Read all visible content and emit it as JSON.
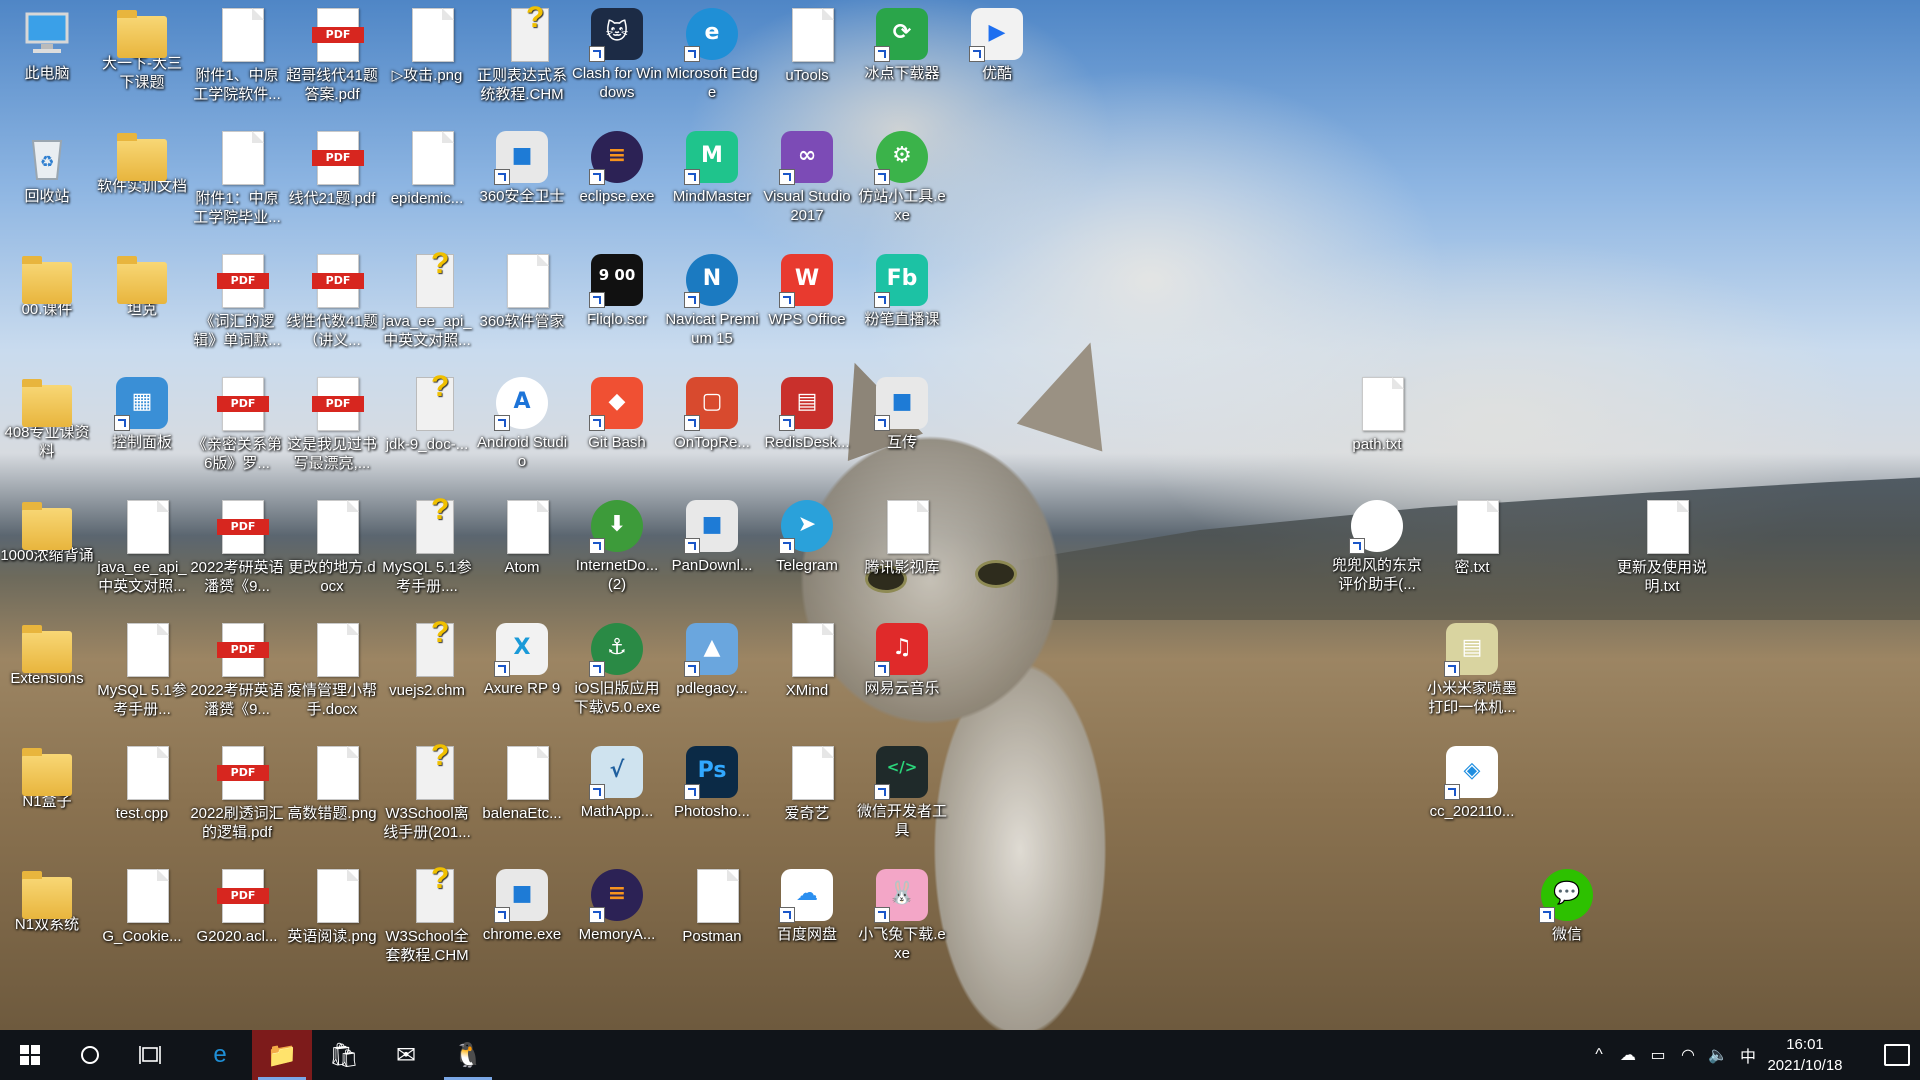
{
  "desktop": {
    "icons": [
      {
        "label": "此电脑",
        "col": 0,
        "row": 0,
        "kind": "computer"
      },
      {
        "label": "大一下-大三下课题",
        "col": 1,
        "row": 0,
        "kind": "folder"
      },
      {
        "label": "附件1、中原工学院软件...",
        "col": 2,
        "row": 0,
        "kind": "doc"
      },
      {
        "label": "超哥线代41题答案.pdf",
        "col": 3,
        "row": 0,
        "kind": "pdf"
      },
      {
        "label": "▷攻击.png",
        "col": 4,
        "row": 0,
        "kind": "doc"
      },
      {
        "label": "正则表达式系统教程.CHM",
        "col": 5,
        "row": 0,
        "kind": "chm"
      },
      {
        "label": "Clash for Windows",
        "col": 6,
        "row": 0,
        "kind": "app",
        "color": "#1c2b45",
        "text": "🐱"
      },
      {
        "label": "Microsoft Edge",
        "col": 7,
        "row": 0,
        "kind": "round",
        "color": "#1f8fd6",
        "text": "e"
      },
      {
        "label": "uTools",
        "col": 8,
        "row": 0,
        "kind": "doc"
      },
      {
        "label": "冰点下载器",
        "col": 9,
        "row": 0,
        "kind": "app",
        "color": "#2aa54a",
        "text": "⟳"
      },
      {
        "label": "优酷",
        "col": 10,
        "row": 0,
        "kind": "app",
        "color": "#f2f2f2",
        "text": "▶",
        "tcolor": "#1e6ff0"
      },
      {
        "label": "回收站",
        "col": 0,
        "row": 1,
        "kind": "bin"
      },
      {
        "label": "软件实训文档",
        "col": 1,
        "row": 1,
        "kind": "folder"
      },
      {
        "label": "附件1：中原工学院毕业...",
        "col": 2,
        "row": 1,
        "kind": "doc"
      },
      {
        "label": "线代21题.pdf",
        "col": 3,
        "row": 1,
        "kind": "pdf"
      },
      {
        "label": "epidemic...",
        "col": 4,
        "row": 1,
        "kind": "doc"
      },
      {
        "label": "360安全卫士",
        "col": 5,
        "row": 1,
        "kind": "app",
        "color": "#e8e8e8",
        "text": "■",
        "tcolor": "#1e7bd6"
      },
      {
        "label": "eclipse.exe",
        "col": 6,
        "row": 1,
        "kind": "round",
        "color": "#2c2255",
        "text": "≡",
        "tcolor": "#f7941e"
      },
      {
        "label": "MindMaster",
        "col": 7,
        "row": 1,
        "kind": "app",
        "color": "#1fc48c",
        "text": "M"
      },
      {
        "label": "Visual Studio 2017",
        "col": 8,
        "row": 1,
        "kind": "app",
        "color": "#7c4bb6",
        "text": "∞"
      },
      {
        "label": "仿站小工具.exe",
        "col": 9,
        "row": 1,
        "kind": "round",
        "color": "#3bb34a",
        "text": "⚙"
      },
      {
        "label": "00.课件",
        "col": 0,
        "row": 2,
        "kind": "folder"
      },
      {
        "label": "坦克",
        "col": 1,
        "row": 2,
        "kind": "folder"
      },
      {
        "label": "《词汇的逻辑》单词默...",
        "col": 2,
        "row": 2,
        "kind": "pdf"
      },
      {
        "label": "线性代数41题（讲义...",
        "col": 3,
        "row": 2,
        "kind": "pdf"
      },
      {
        "label": "java_ee_api_中英文对照...",
        "col": 4,
        "row": 2,
        "kind": "chm"
      },
      {
        "label": "360软件管家",
        "col": 5,
        "row": 2,
        "kind": "doc"
      },
      {
        "label": "Fliqlo.scr",
        "col": 6,
        "row": 2,
        "kind": "app",
        "color": "#111111",
        "text": "9 00"
      },
      {
        "label": "Navicat Premium 15",
        "col": 7,
        "row": 2,
        "kind": "round",
        "color": "#1b7ac1",
        "text": "N"
      },
      {
        "label": "WPS Office",
        "col": 8,
        "row": 2,
        "kind": "app",
        "color": "#e83a2f",
        "text": "W"
      },
      {
        "label": "粉笔直播课",
        "col": 9,
        "row": 2,
        "kind": "app",
        "color": "#1cc2a4",
        "text": "Fb"
      },
      {
        "label": "408专业课资料",
        "col": 0,
        "row": 3,
        "kind": "folder"
      },
      {
        "label": "控制面板",
        "col": 1,
        "row": 3,
        "kind": "app",
        "color": "#3a8fd6",
        "text": "▦"
      },
      {
        "label": "《亲密关系第6版》罗...",
        "col": 2,
        "row": 3,
        "kind": "pdf"
      },
      {
        "label": "这是我见过书写最漂亮,...",
        "col": 3,
        "row": 3,
        "kind": "pdf"
      },
      {
        "label": "jdk-9_doc-...",
        "col": 4,
        "row": 3,
        "kind": "chm"
      },
      {
        "label": "Android Studio",
        "col": 5,
        "row": 3,
        "kind": "round",
        "color": "#ffffff",
        "text": "A",
        "tcolor": "#1d74d8"
      },
      {
        "label": "Git Bash",
        "col": 6,
        "row": 3,
        "kind": "app",
        "color": "#f05033",
        "text": "◆"
      },
      {
        "label": "OnTopRe...",
        "col": 7,
        "row": 3,
        "kind": "app",
        "color": "#d84a2e",
        "text": "▢"
      },
      {
        "label": "RedisDesk...",
        "col": 8,
        "row": 3,
        "kind": "app",
        "color": "#c9302c",
        "text": "▤"
      },
      {
        "label": "互传",
        "col": 9,
        "row": 3,
        "kind": "app",
        "color": "#e8e8e8",
        "text": "■",
        "tcolor": "#1e7bd6"
      },
      {
        "label": "1000浓缩背诵",
        "col": 0,
        "row": 4,
        "kind": "folder"
      },
      {
        "label": "java_ee_api_中英文对照...",
        "col": 1,
        "row": 4,
        "kind": "doc"
      },
      {
        "label": "2022考研英语潘赟《9...",
        "col": 2,
        "row": 4,
        "kind": "pdf"
      },
      {
        "label": "更改的地方.docx",
        "col": 3,
        "row": 4,
        "kind": "doc"
      },
      {
        "label": "MySQL 5.1参考手册....",
        "col": 4,
        "row": 4,
        "kind": "chm"
      },
      {
        "label": "Atom",
        "col": 5,
        "row": 4,
        "kind": "doc"
      },
      {
        "label": "InternetDo... (2)",
        "col": 6,
        "row": 4,
        "kind": "round",
        "color": "#3d9b3a",
        "text": "⬇"
      },
      {
        "label": "PanDownl...",
        "col": 7,
        "row": 4,
        "kind": "app",
        "color": "#e8e8e8",
        "text": "■",
        "tcolor": "#1e7bd6"
      },
      {
        "label": "Telegram",
        "col": 8,
        "row": 4,
        "kind": "round",
        "color": "#2aa1da",
        "text": "➤"
      },
      {
        "label": "腾讯影视库",
        "col": 9,
        "row": 4,
        "kind": "doc"
      },
      {
        "label": "Extensions",
        "col": 0,
        "row": 5,
        "kind": "folder"
      },
      {
        "label": "MySQL 5.1参考手册...",
        "col": 1,
        "row": 5,
        "kind": "doc"
      },
      {
        "label": "2022考研英语潘赟《9...",
        "col": 2,
        "row": 5,
        "kind": "pdf"
      },
      {
        "label": "疫情管理小帮手.docx",
        "col": 3,
        "row": 5,
        "kind": "doc"
      },
      {
        "label": "vuejs2.chm",
        "col": 4,
        "row": 5,
        "kind": "chm"
      },
      {
        "label": "Axure RP 9",
        "col": 5,
        "row": 5,
        "kind": "app",
        "color": "#f2f2f2",
        "text": "X",
        "tcolor": "#1a9ad8"
      },
      {
        "label": "iOS旧版应用下载v5.0.exe",
        "col": 6,
        "row": 5,
        "kind": "round",
        "color": "#2a8a45",
        "text": "⚓"
      },
      {
        "label": "pdlegacy...",
        "col": 7,
        "row": 5,
        "kind": "app",
        "color": "#6aa6de",
        "text": "▲"
      },
      {
        "label": "XMind",
        "col": 8,
        "row": 5,
        "kind": "doc"
      },
      {
        "label": "网易云音乐",
        "col": 9,
        "row": 5,
        "kind": "app",
        "color": "#e02a2a",
        "text": "♫"
      },
      {
        "label": "N1盒子",
        "col": 0,
        "row": 6,
        "kind": "folder"
      },
      {
        "label": "test.cpp",
        "col": 1,
        "row": 6,
        "kind": "doc"
      },
      {
        "label": "2022刷透词汇的逻辑.pdf",
        "col": 2,
        "row": 6,
        "kind": "pdf"
      },
      {
        "label": "高数错题.png",
        "col": 3,
        "row": 6,
        "kind": "doc"
      },
      {
        "label": "W3School离线手册(201...",
        "col": 4,
        "row": 6,
        "kind": "chm"
      },
      {
        "label": "balenaEtc...",
        "col": 5,
        "row": 6,
        "kind": "doc"
      },
      {
        "label": "MathApp...",
        "col": 6,
        "row": 6,
        "kind": "app",
        "color": "#cfe3ef",
        "text": "√",
        "tcolor": "#1f5f9e"
      },
      {
        "label": "Photosho...",
        "col": 7,
        "row": 6,
        "kind": "app",
        "color": "#0b2a46",
        "text": "Ps",
        "tcolor": "#31a8ff"
      },
      {
        "label": "爱奇艺",
        "col": 8,
        "row": 6,
        "kind": "doc"
      },
      {
        "label": "微信开发者工具",
        "col": 9,
        "row": 6,
        "kind": "app",
        "color": "#1f2a2a",
        "text": "</>",
        "tcolor": "#2bd67b"
      },
      {
        "label": "N1双系统",
        "col": 0,
        "row": 7,
        "kind": "folder"
      },
      {
        "label": "G_Cookie...",
        "col": 1,
        "row": 7,
        "kind": "doc"
      },
      {
        "label": "G2020.acl...",
        "col": 2,
        "row": 7,
        "kind": "pdf"
      },
      {
        "label": "英语阅读.png",
        "col": 3,
        "row": 7,
        "kind": "doc"
      },
      {
        "label": "W3School全套教程.CHM",
        "col": 4,
        "row": 7,
        "kind": "chm"
      },
      {
        "label": "chrome.exe",
        "col": 5,
        "row": 7,
        "kind": "app",
        "color": "#e8e8e8",
        "text": "■",
        "tcolor": "#1e7bd6"
      },
      {
        "label": "MemoryA...",
        "col": 6,
        "row": 7,
        "kind": "round",
        "color": "#2c2255",
        "text": "≡",
        "tcolor": "#f7941e"
      },
      {
        "label": "Postman",
        "col": 7,
        "row": 7,
        "kind": "doc"
      },
      {
        "label": "百度网盘",
        "col": 8,
        "row": 7,
        "kind": "app",
        "color": "#ffffff",
        "text": "☁",
        "tcolor": "#2b8ff0"
      },
      {
        "label": "小飞兔下载.exe",
        "col": 9,
        "row": 7,
        "kind": "app",
        "color": "#f3a6c7",
        "text": "🐰"
      },
      {
        "label": "path.txt",
        "col": 14,
        "row": 3,
        "kind": "doc"
      },
      {
        "label": "兜兜风的东京评价助手(...",
        "col": 14,
        "row": 4,
        "kind": "round",
        "color": "#ffffff",
        "text": "🐭"
      },
      {
        "label": "密.txt",
        "col": 15,
        "row": 4,
        "kind": "doc"
      },
      {
        "label": "更新及使用说明.txt",
        "col": 17,
        "row": 4,
        "kind": "doc"
      },
      {
        "label": "小米米家喷墨打印一体机...",
        "col": 15,
        "row": 5,
        "kind": "app",
        "color": "#d9d4a0",
        "text": "▤"
      },
      {
        "label": "cc_202110...",
        "col": 15,
        "row": 6,
        "kind": "app",
        "color": "#ffffff",
        "text": "◈",
        "tcolor": "#1f8ee0"
      },
      {
        "label": "微信",
        "col": 16,
        "row": 7,
        "kind": "round",
        "color": "#2dc100",
        "text": "💬"
      }
    ]
  },
  "taskbar": {
    "start_icon": "windows-start-icon",
    "search_icon": "cortana-circle-icon",
    "taskview_icon": "task-view-icon",
    "pinned": [
      {
        "name": "edge",
        "glyph": "e",
        "color": "#1f8fd6",
        "active": false,
        "running": false
      },
      {
        "name": "file-explorer",
        "glyph": "📁",
        "color": "#f3c53a",
        "active": true,
        "running": true
      },
      {
        "name": "microsoft-store",
        "glyph": "🛍",
        "color": "#ffffff",
        "active": false,
        "running": false
      },
      {
        "name": "mail",
        "glyph": "✉",
        "color": "#ffffff",
        "active": false,
        "running": false
      },
      {
        "name": "qq",
        "glyph": "🐧",
        "color": "#ffd000",
        "active": false,
        "running": true
      }
    ],
    "tray": {
      "chevron": "^",
      "ime": "中",
      "time": "16:01",
      "date": "2021/10/18"
    }
  }
}
